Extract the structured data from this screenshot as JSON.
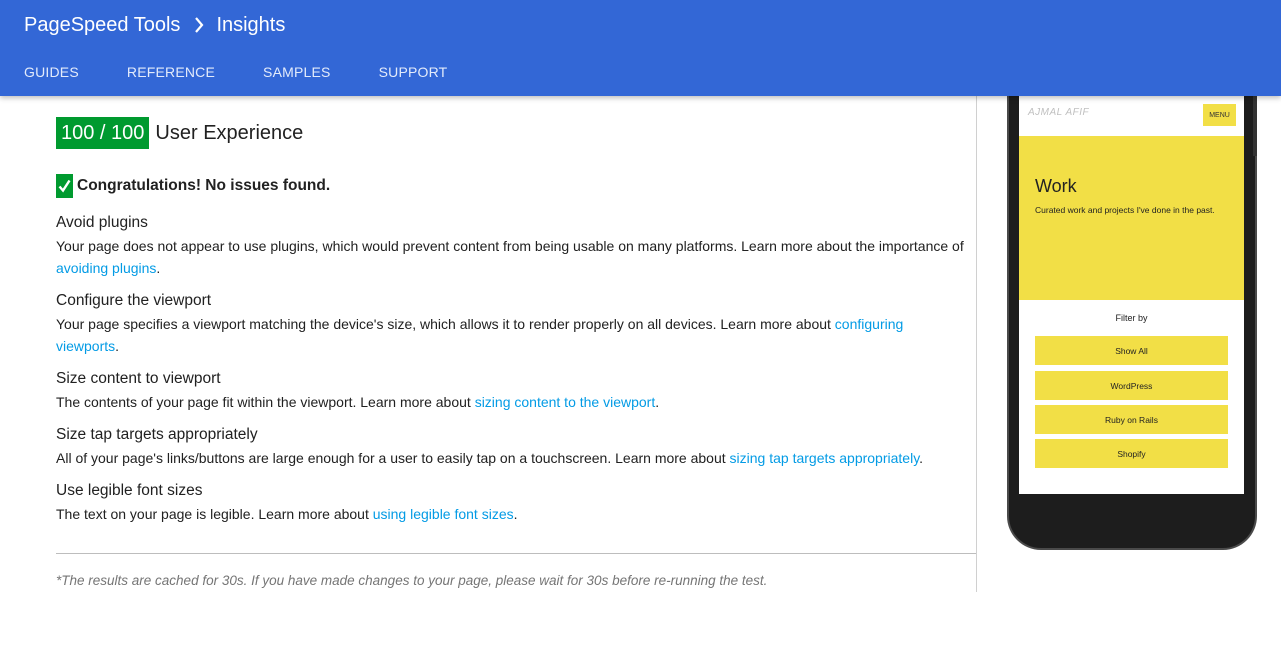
{
  "header": {
    "brand": "PageSpeed Tools",
    "current": "Insights",
    "nav": [
      "GUIDES",
      "REFERENCE",
      "SAMPLES",
      "SUPPORT"
    ]
  },
  "summary": {
    "score": "100 / 100",
    "category": "User Experience",
    "congrats": "Congratulations! No issues found."
  },
  "rules": [
    {
      "title": "Avoid plugins",
      "text": "Your page does not appear to use plugins, which would prevent content from being usable on many platforms. Learn more about the importance of ",
      "link": "avoiding plugins",
      "end": "."
    },
    {
      "title": "Configure the viewport",
      "text": "Your page specifies a viewport matching the device's size, which allows it to render properly on all devices. Learn more about ",
      "link": "configuring viewports",
      "end": "."
    },
    {
      "title": "Size content to viewport",
      "text": "The contents of your page fit within the viewport. Learn more about ",
      "link": "sizing content to the viewport",
      "end": "."
    },
    {
      "title": "Size tap targets appropriately",
      "text": "All of your page's links/buttons are large enough for a user to easily tap on a touchscreen. Learn more about ",
      "link": "sizing tap targets appropriately",
      "end": "."
    },
    {
      "title": "Use legible font sizes",
      "text": "The text on your page is legible. Learn more about ",
      "link": "using legible font sizes",
      "end": "."
    }
  ],
  "footnote": "*The results are cached for 30s. If you have made changes to your page, please wait for 30s before re-running the test.",
  "preview": {
    "logo": "AJMAL AFIF",
    "menu": "MENU",
    "hero_title": "Work",
    "hero_desc": "Curated work and projects I've done in the past.",
    "filter_label": "Filter by",
    "filters": [
      "Show All",
      "WordPress",
      "Ruby on Rails",
      "Shopify"
    ]
  },
  "colors": {
    "header": "#3367d6",
    "score_bg": "#009a2f",
    "link": "#039be5",
    "preview_accent": "#f2df46"
  }
}
